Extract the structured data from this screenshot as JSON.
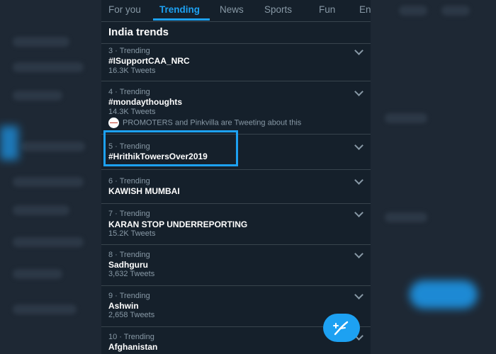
{
  "tabs": [
    {
      "label": "For you"
    },
    {
      "label": "Trending"
    },
    {
      "label": "News"
    },
    {
      "label": "Sports"
    },
    {
      "label": "Fun"
    },
    {
      "label": "En"
    }
  ],
  "active_tab": "Trending",
  "section_title": "India trends",
  "trends": [
    {
      "meta": "3 · Trending",
      "name": "#ISupportCAA_NRC",
      "count": "16.3K Tweets"
    },
    {
      "meta": "4 · Trending",
      "name": "#mondaythoughts",
      "count": "14.3K Tweets",
      "context": "PROMOTERS and Pinkvilla are Tweeting about this"
    },
    {
      "meta": "5 · Trending",
      "name": "#HrithikTowersOver2019"
    },
    {
      "meta": "6 · Trending",
      "name": "KAWISH MUMBAI"
    },
    {
      "meta": "7 · Trending",
      "name": "KARAN STOP UNDERREPORTING",
      "count": "15.2K Tweets"
    },
    {
      "meta": "8 · Trending",
      "name": "Sadhguru",
      "count": "3,632 Tweets"
    },
    {
      "meta": "9 · Trending",
      "name": "Ashwin",
      "count": "2,658 Tweets"
    },
    {
      "meta": "10 · Trending",
      "name": "Afghanistan"
    }
  ],
  "colors": {
    "accent": "#1da1f2",
    "background": "#15202b",
    "text_primary": "#ffffff",
    "text_secondary": "#8899a6"
  },
  "icons": {
    "chevron": "chevron-down-icon",
    "compose": "compose-tweet-icon"
  }
}
